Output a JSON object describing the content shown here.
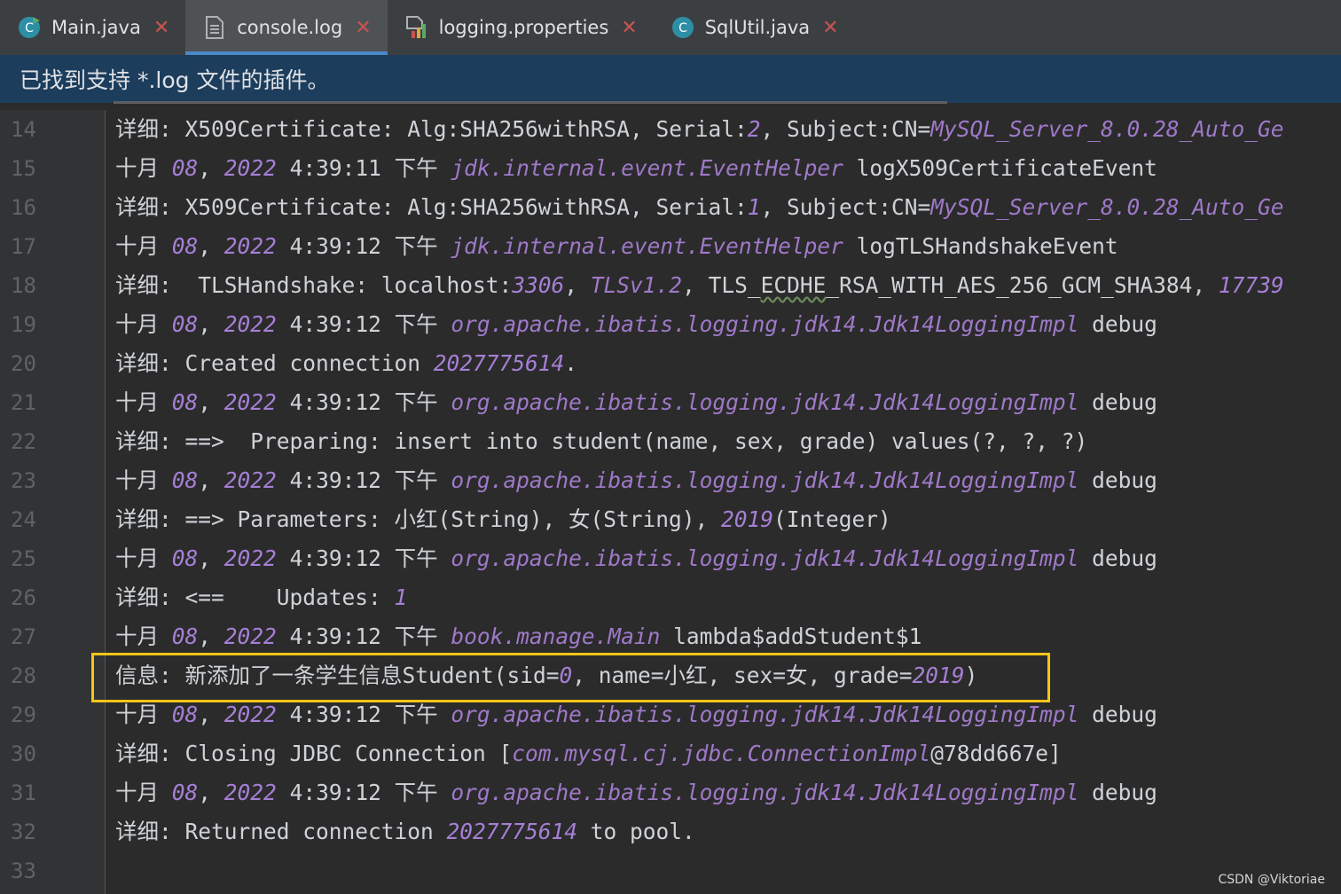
{
  "tabs": [
    {
      "label": "Main.java",
      "icon": "java-class-run-icon",
      "active": false
    },
    {
      "label": "console.log",
      "icon": "text-file-icon",
      "active": true
    },
    {
      "label": "logging.properties",
      "icon": "properties-file-icon",
      "active": false
    },
    {
      "label": "SqlUtil.java",
      "icon": "java-class-icon",
      "active": false
    }
  ],
  "close_glyph": "✕",
  "banner": {
    "text": "已找到支持 *.log 文件的插件。"
  },
  "lines": [
    {
      "n": "14",
      "segs": [
        [
          "t",
          "详细: X509Certificate: Alg:SHA256withRSA, Serial:"
        ],
        [
          "n",
          "2"
        ],
        [
          "t",
          ", Subject:CN="
        ],
        [
          "c",
          "MySQL_Server_8.0.28_Auto_Ge"
        ]
      ]
    },
    {
      "n": "15",
      "segs": [
        [
          "t",
          "十月 "
        ],
        [
          "n",
          "08"
        ],
        [
          "t",
          ", "
        ],
        [
          "n",
          "2022"
        ],
        [
          "t",
          " 4:39:11 下午 "
        ],
        [
          "c",
          "jdk.internal.event.EventHelper"
        ],
        [
          "t",
          " logX509CertificateEvent"
        ]
      ]
    },
    {
      "n": "16",
      "segs": [
        [
          "t",
          "详细: X509Certificate: Alg:SHA256withRSA, Serial:"
        ],
        [
          "n",
          "1"
        ],
        [
          "t",
          ", Subject:CN="
        ],
        [
          "c",
          "MySQL_Server_8.0.28_Auto_Ge"
        ]
      ]
    },
    {
      "n": "17",
      "segs": [
        [
          "t",
          "十月 "
        ],
        [
          "n",
          "08"
        ],
        [
          "t",
          ", "
        ],
        [
          "n",
          "2022"
        ],
        [
          "t",
          " 4:39:12 下午 "
        ],
        [
          "c",
          "jdk.internal.event.EventHelper"
        ],
        [
          "t",
          " logTLSHandshakeEvent"
        ]
      ]
    },
    {
      "n": "18",
      "segs": [
        [
          "t",
          "详细:  TLSHandshake: localhost:"
        ],
        [
          "n",
          "3306"
        ],
        [
          "t",
          ", "
        ],
        [
          "c",
          "TLSv1.2"
        ],
        [
          "t",
          ", TLS_"
        ],
        [
          "w",
          "ECDHE"
        ],
        [
          "t",
          "_RSA_WITH_AES_256_GCM_SHA384, "
        ],
        [
          "n",
          "17739"
        ]
      ]
    },
    {
      "n": "19",
      "segs": [
        [
          "t",
          "十月 "
        ],
        [
          "n",
          "08"
        ],
        [
          "t",
          ", "
        ],
        [
          "n",
          "2022"
        ],
        [
          "t",
          " 4:39:12 下午 "
        ],
        [
          "c",
          "org.apache.ibatis.logging.jdk14.Jdk14LoggingImpl"
        ],
        [
          "t",
          " debug"
        ]
      ]
    },
    {
      "n": "20",
      "segs": [
        [
          "t",
          "详细: Created connection "
        ],
        [
          "n",
          "2027775614"
        ],
        [
          "t",
          "."
        ]
      ]
    },
    {
      "n": "21",
      "segs": [
        [
          "t",
          "十月 "
        ],
        [
          "n",
          "08"
        ],
        [
          "t",
          ", "
        ],
        [
          "n",
          "2022"
        ],
        [
          "t",
          " 4:39:12 下午 "
        ],
        [
          "c",
          "org.apache.ibatis.logging.jdk14.Jdk14LoggingImpl"
        ],
        [
          "t",
          " debug"
        ]
      ]
    },
    {
      "n": "22",
      "segs": [
        [
          "t",
          "详细: ==>  Preparing: insert into student(name, sex, grade) values(?, ?, ?)"
        ]
      ]
    },
    {
      "n": "23",
      "segs": [
        [
          "t",
          "十月 "
        ],
        [
          "n",
          "08"
        ],
        [
          "t",
          ", "
        ],
        [
          "n",
          "2022"
        ],
        [
          "t",
          " 4:39:12 下午 "
        ],
        [
          "c",
          "org.apache.ibatis.logging.jdk14.Jdk14LoggingImpl"
        ],
        [
          "t",
          " debug"
        ]
      ]
    },
    {
      "n": "24",
      "segs": [
        [
          "t",
          "详细: ==> Parameters: 小红(String), 女(String), "
        ],
        [
          "n",
          "2019"
        ],
        [
          "t",
          "(Integer)"
        ]
      ]
    },
    {
      "n": "25",
      "segs": [
        [
          "t",
          "十月 "
        ],
        [
          "n",
          "08"
        ],
        [
          "t",
          ", "
        ],
        [
          "n",
          "2022"
        ],
        [
          "t",
          " 4:39:12 下午 "
        ],
        [
          "c",
          "org.apache.ibatis.logging.jdk14.Jdk14LoggingImpl"
        ],
        [
          "t",
          " debug"
        ]
      ]
    },
    {
      "n": "26",
      "segs": [
        [
          "t",
          "详细: <==    Updates: "
        ],
        [
          "n",
          "1"
        ]
      ]
    },
    {
      "n": "27",
      "segs": [
        [
          "t",
          "十月 "
        ],
        [
          "n",
          "08"
        ],
        [
          "t",
          ", "
        ],
        [
          "n",
          "2022"
        ],
        [
          "t",
          " 4:39:12 下午 "
        ],
        [
          "c",
          "book.manage.Main"
        ],
        [
          "t",
          " lambda$addStudent$1"
        ]
      ]
    },
    {
      "n": "28",
      "segs": [
        [
          "t",
          "信息: 新添加了一条学生信息Student(sid="
        ],
        [
          "n",
          "0"
        ],
        [
          "t",
          ", name=小红, sex=女, grade="
        ],
        [
          "n",
          "2019"
        ],
        [
          "t",
          ")"
        ]
      ]
    },
    {
      "n": "29",
      "segs": [
        [
          "t",
          "十月 "
        ],
        [
          "n",
          "08"
        ],
        [
          "t",
          ", "
        ],
        [
          "n",
          "2022"
        ],
        [
          "t",
          " 4:39:12 下午 "
        ],
        [
          "c",
          "org.apache.ibatis.logging.jdk14.Jdk14LoggingImpl"
        ],
        [
          "t",
          " debug"
        ]
      ]
    },
    {
      "n": "30",
      "segs": [
        [
          "t",
          "详细: Closing JDBC Connection ["
        ],
        [
          "c",
          "com.mysql.cj.jdbc.ConnectionImpl"
        ],
        [
          "t",
          "@78dd667e]"
        ]
      ]
    },
    {
      "n": "31",
      "segs": [
        [
          "t",
          "十月 "
        ],
        [
          "n",
          "08"
        ],
        [
          "t",
          ", "
        ],
        [
          "n",
          "2022"
        ],
        [
          "t",
          " 4:39:12 下午 "
        ],
        [
          "c",
          "org.apache.ibatis.logging.jdk14.Jdk14LoggingImpl"
        ],
        [
          "t",
          " debug"
        ]
      ]
    },
    {
      "n": "32",
      "segs": [
        [
          "t",
          "详细: Returned connection "
        ],
        [
          "n",
          "2027775614"
        ],
        [
          "t",
          " to pool."
        ]
      ]
    },
    {
      "n": "33",
      "segs": []
    }
  ],
  "watermark": "CSDN @Viktoriae",
  "colors": {
    "tab_bar": "#3c3f41",
    "banner": "#1c3d5c",
    "editor_bg": "#2b2b2b",
    "number": "#a67fd6",
    "class_ref": "#9f79c9",
    "highlight_box": "#f5c518"
  }
}
